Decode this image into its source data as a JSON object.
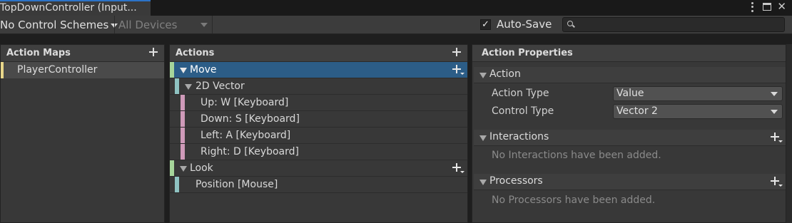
{
  "window": {
    "tab_title": "TopDownController (Input..."
  },
  "toolbar": {
    "control_scheme": "No Control Schemes",
    "devices": "All Devices",
    "auto_save_label": "Auto-Save",
    "auto_save_checked": true,
    "search_placeholder": ""
  },
  "action_maps": {
    "header": "Action Maps",
    "items": [
      {
        "label": "PlayerController",
        "selected": true,
        "color": "#e8d68a"
      }
    ]
  },
  "actions": {
    "header": "Actions",
    "colors": {
      "action": "#a6d59a",
      "composite": "#8fc3c2",
      "binding": "#cf9ab9"
    },
    "items": [
      {
        "label": "Move"
      },
      {
        "label": "2D Vector"
      },
      {
        "label": "Up: W [Keyboard]"
      },
      {
        "label": "Down: S [Keyboard]"
      },
      {
        "label": "Left: A [Keyboard]"
      },
      {
        "label": "Right: D [Keyboard]"
      },
      {
        "label": "Look"
      },
      {
        "label": "Position [Mouse]"
      }
    ]
  },
  "properties": {
    "header": "Action Properties",
    "action_section": "Action",
    "action_type_label": "Action Type",
    "action_type_value": "Value",
    "control_type_label": "Control Type",
    "control_type_value": "Vector 2",
    "interactions_section": "Interactions",
    "interactions_empty": "No Interactions have been added.",
    "processors_section": "Processors",
    "processors_empty": "No Processors have been added."
  },
  "accent_colors": {
    "selection": "#2c5d87",
    "tab_highlight": "#2c73c7"
  }
}
